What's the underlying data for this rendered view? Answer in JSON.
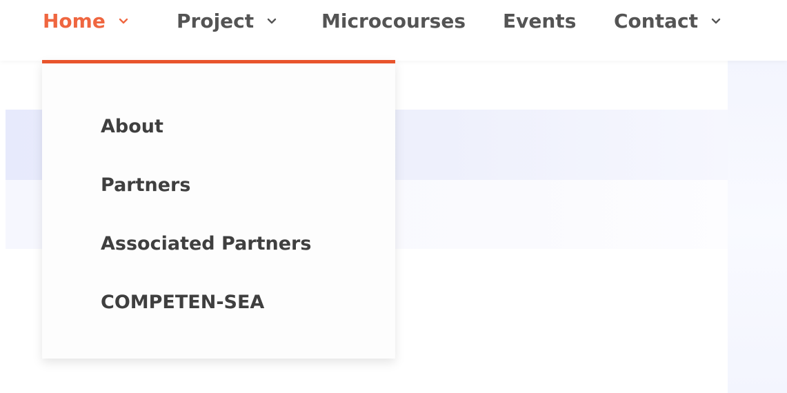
{
  "nav": {
    "items": [
      {
        "label": "Home",
        "has_dropdown": true,
        "active": true
      },
      {
        "label": "Project",
        "has_dropdown": true,
        "active": false
      },
      {
        "label": "Microcourses",
        "has_dropdown": false,
        "active": false
      },
      {
        "label": "Events",
        "has_dropdown": false,
        "active": false
      },
      {
        "label": "Contact",
        "has_dropdown": true,
        "active": false
      }
    ]
  },
  "dropdown": {
    "items": [
      {
        "label": "About"
      },
      {
        "label": "Partners"
      },
      {
        "label": "Associated Partners"
      },
      {
        "label": "COMPETEN-SEA"
      }
    ]
  },
  "icons": {
    "dropdown_indicator": "chevron-down-icon"
  },
  "colors": {
    "accent": "#ef6640",
    "accent_border": "#e8542c",
    "nav_text": "#545454",
    "menu_text": "#3f3f3f"
  }
}
